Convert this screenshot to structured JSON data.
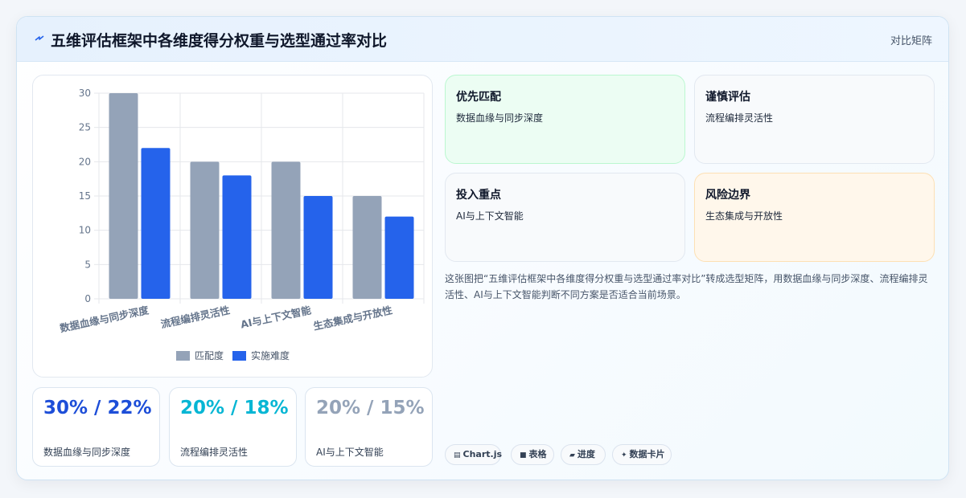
{
  "header": {
    "title": "五维评估框架中各维度得分权重与选型通过率对比",
    "tag": "对比矩阵"
  },
  "chart_data": {
    "type": "bar",
    "categories": [
      "数据血缘与同步深度",
      "流程编排灵活性",
      "AI与上下文智能",
      "生态集成与开放性"
    ],
    "series": [
      {
        "name": "匹配度",
        "values": [
          30,
          20,
          20,
          15
        ],
        "color": "#94a3b8"
      },
      {
        "name": "实施难度",
        "values": [
          22,
          18,
          15,
          12
        ],
        "color": "#2563eb"
      }
    ],
    "ylim": [
      0,
      30
    ],
    "yticks": [
      0,
      5,
      10,
      15,
      20,
      25,
      30
    ],
    "grid": true,
    "legend": "bottom"
  },
  "stats": [
    {
      "value": "30% / 22%",
      "label": "数据血缘与同步深度",
      "color": "#1d4ed8"
    },
    {
      "value": "20% / 18%",
      "label": "流程编排灵活性",
      "color": "#06b6d4"
    },
    {
      "value": "20% / 15%",
      "label": "AI与上下文智能",
      "color": "#94a3b8"
    }
  ],
  "tiles": [
    {
      "title": "优先匹配",
      "body": "数据血缘与同步深度",
      "bg": "#ecfdf3",
      "border": "#bbf7d0"
    },
    {
      "title": "谨慎评估",
      "body": "流程编排灵活性",
      "bg": "#f8fafc",
      "border": "#e2e8f0"
    },
    {
      "title": "投入重点",
      "body": "AI与上下文智能",
      "bg": "#f8fafc",
      "border": "#e2e8f0"
    },
    {
      "title": "风险边界",
      "body": "生态集成与开放性",
      "bg": "#fff7eb",
      "border": "#fde0b4"
    }
  ],
  "summary": "这张图把“五维评估框架中各维度得分权重与选型通过率对比”转成选型矩阵，用数据血缘与同步深度、流程编排灵活性、AI与上下文智能判断不同方案是否适合当前场景。",
  "chips": [
    {
      "icon": "▤",
      "label": "Chart.js"
    },
    {
      "icon": "■",
      "label": "表格"
    },
    {
      "icon": "▰",
      "label": "进度"
    },
    {
      "icon": "✦",
      "label": "数据卡片"
    }
  ]
}
